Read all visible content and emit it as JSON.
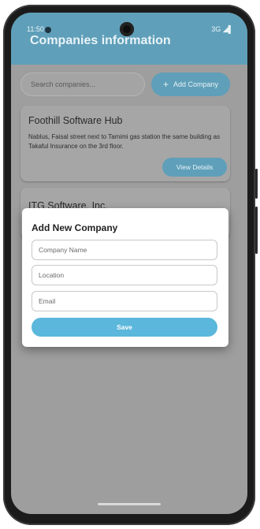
{
  "status_bar": {
    "time": "11:50",
    "network": "3G ◢▌"
  },
  "app_bar": {
    "title": "Companies information"
  },
  "search": {
    "placeholder": "Search companies..."
  },
  "add_company_button": {
    "icon": "plus-icon",
    "label": "Add Company"
  },
  "companies": [
    {
      "name": "Foothill Software Hub",
      "address": "Nablus, Faisal street next to Tamimi gas station the same building as Takaful Insurance on the 3rd floor.",
      "button_label": "View Details"
    },
    {
      "name": "ITG Software, Inc."
    }
  ],
  "dialog": {
    "title": "Add New Company",
    "fields": {
      "name_placeholder": "Company Name",
      "location_placeholder": "Location",
      "email_placeholder": "Email"
    },
    "save_label": "Save"
  },
  "colors": {
    "accent": "#5f9fb9",
    "save_button": "#5bb7db",
    "scrim": "#9e9e9e"
  }
}
